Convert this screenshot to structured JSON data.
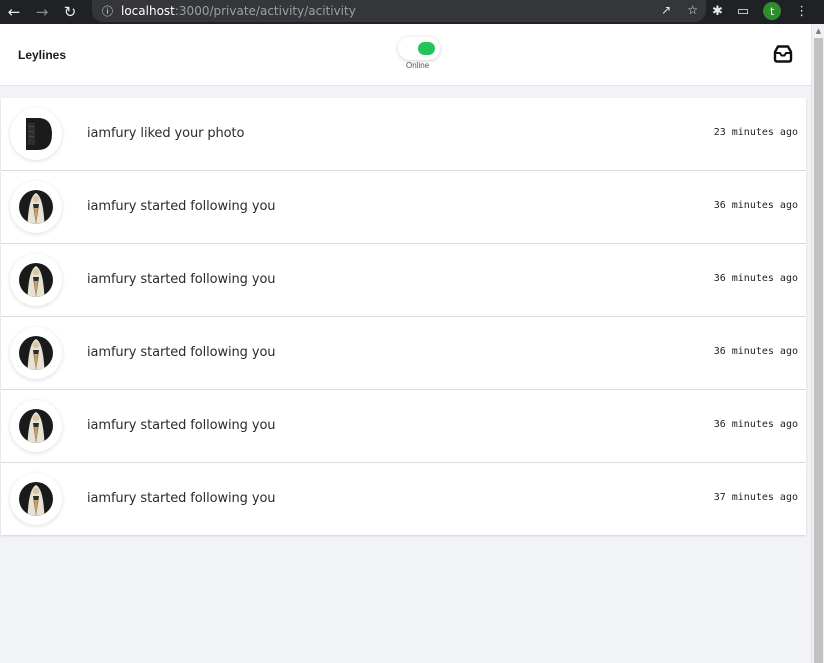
{
  "browser": {
    "url_host": "localhost",
    "url_path": ":3000/private/activity/acitivity",
    "profile_initial": "t"
  },
  "header": {
    "brand": "Leylines",
    "status_label": "Online",
    "status_color": "#23c45a"
  },
  "activities": [
    {
      "text": "iamfury liked your photo",
      "time": "23 minutes ago",
      "avatar": "photo-thumbnail"
    },
    {
      "text": "iamfury started following you",
      "time": "36 minutes ago",
      "avatar": "user-avatar"
    },
    {
      "text": "iamfury started following you",
      "time": "36 minutes ago",
      "avatar": "user-avatar"
    },
    {
      "text": "iamfury started following you",
      "time": "36 minutes ago",
      "avatar": "user-avatar"
    },
    {
      "text": "iamfury started following you",
      "time": "36 minutes ago",
      "avatar": "user-avatar"
    },
    {
      "text": "iamfury started following you",
      "time": "37 minutes ago",
      "avatar": "user-avatar"
    }
  ]
}
